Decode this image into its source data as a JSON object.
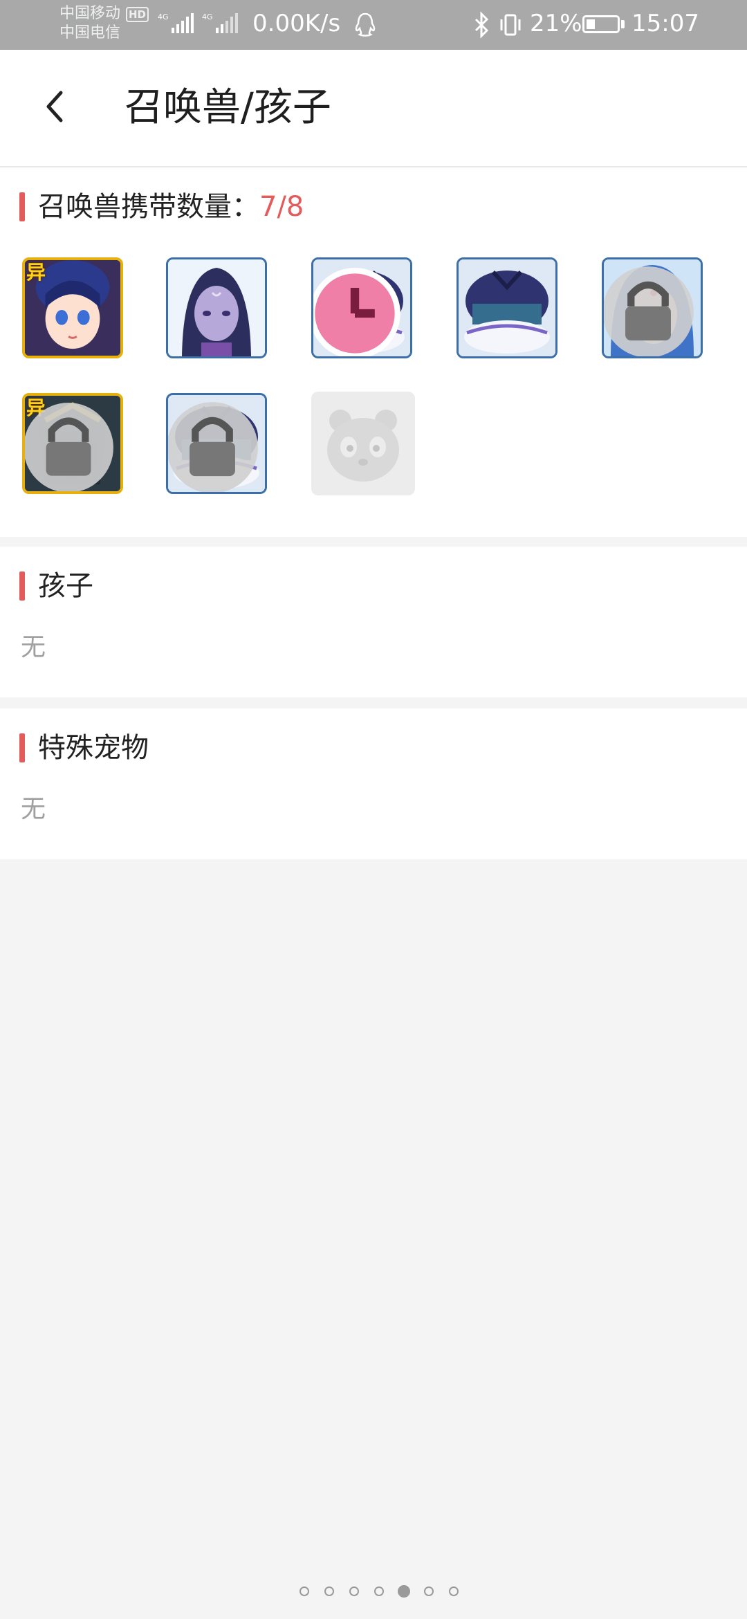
{
  "status_bar": {
    "carrier1": "中国移动",
    "carrier2": "中国电信",
    "hd_badge": "HD",
    "network1": "4G",
    "network2": "4G",
    "speed": "0.00K/s",
    "battery": "21%",
    "time": "15:07",
    "icons": [
      "signal-icon",
      "qq-icon",
      "bluetooth-icon",
      "vibrate-icon",
      "battery-icon"
    ]
  },
  "header": {
    "back_icon": "back-chevron-icon",
    "title": "召唤兽/孩子"
  },
  "summons": {
    "label": "召唤兽携带数量：",
    "count": "7/8",
    "accent": "#e25c5c",
    "items": [
      {
        "type": "portrait-girl",
        "badge": "异",
        "frame": "gold",
        "locked": false
      },
      {
        "type": "portrait-purple-woman",
        "badge": "",
        "frame": "blue",
        "locked": false
      },
      {
        "type": "armored-beast",
        "badge": "",
        "frame": "blue",
        "timer": true
      },
      {
        "type": "armored-beast",
        "badge": "",
        "frame": "blue"
      },
      {
        "type": "portrait-blue-hair",
        "badge": "",
        "frame": "blue",
        "locked": true
      },
      {
        "type": "dark-warrior",
        "badge": "异",
        "frame": "gold",
        "locked": true
      },
      {
        "type": "armored-beast",
        "badge": "",
        "frame": "blue",
        "locked": true
      },
      {
        "type": "empty-slot-panda",
        "badge": "",
        "frame": "none"
      }
    ]
  },
  "children": {
    "label": "孩子",
    "value": "无"
  },
  "special_pets": {
    "label": "特殊宠物",
    "value": "无"
  },
  "pager": {
    "total": 7,
    "active_index": 4
  }
}
